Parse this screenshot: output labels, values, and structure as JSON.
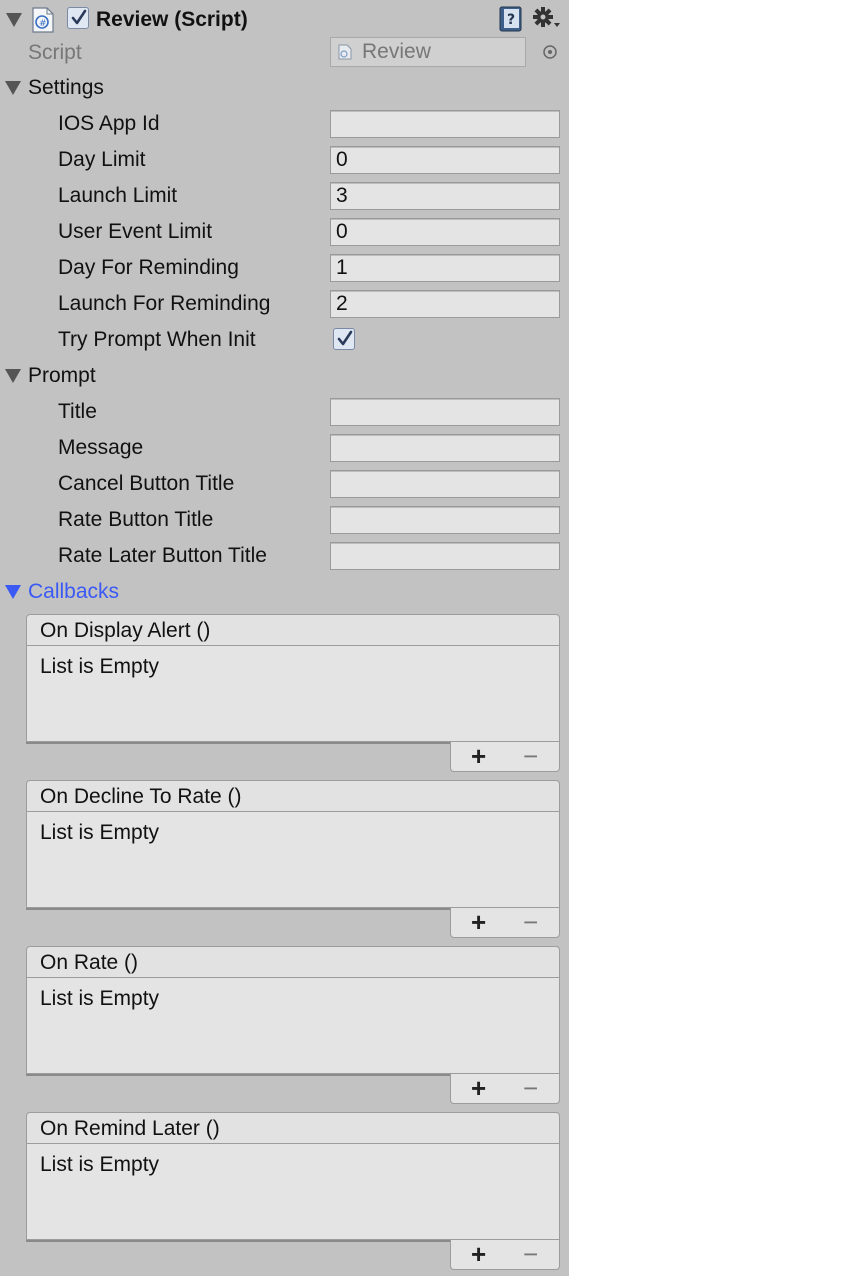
{
  "header": {
    "title": "Review (Script)",
    "enabled": true,
    "script_label": "Script",
    "script_value": "Review"
  },
  "settings": {
    "label": "Settings",
    "fields": [
      {
        "label": "IOS App Id",
        "value": ""
      },
      {
        "label": "Day Limit",
        "value": "0"
      },
      {
        "label": "Launch Limit",
        "value": "3"
      },
      {
        "label": "User Event Limit",
        "value": "0"
      },
      {
        "label": "Day For Reminding",
        "value": "1"
      },
      {
        "label": "Launch For Reminding",
        "value": "2"
      }
    ],
    "try_prompt_label": "Try Prompt When Init",
    "try_prompt_checked": true
  },
  "prompt": {
    "label": "Prompt",
    "fields": [
      {
        "label": "Title",
        "value": ""
      },
      {
        "label": "Message",
        "value": ""
      },
      {
        "label": "Cancel Button Title",
        "value": ""
      },
      {
        "label": "Rate Button Title",
        "value": ""
      },
      {
        "label": "Rate Later Button Title",
        "value": ""
      }
    ]
  },
  "callbacks": {
    "label": "Callbacks",
    "events": [
      {
        "title": "On Display Alert ()",
        "body": "List is Empty"
      },
      {
        "title": "On Decline To Rate ()",
        "body": "List is Empty"
      },
      {
        "title": "On Rate ()",
        "body": "List is Empty"
      },
      {
        "title": "On Remind Later ()",
        "body": "List is Empty"
      }
    ],
    "add_label": "+",
    "remove_label": "−"
  },
  "colors": {
    "panel_bg": "#c2c2c2",
    "field_bg": "#e4e4e4",
    "foldout_active": "#3a59f5"
  },
  "icons": [
    "foldout-arrow-icon",
    "csharp-script-icon",
    "checkbox-icon",
    "help-book-icon",
    "gear-icon",
    "object-picker-icon"
  ]
}
